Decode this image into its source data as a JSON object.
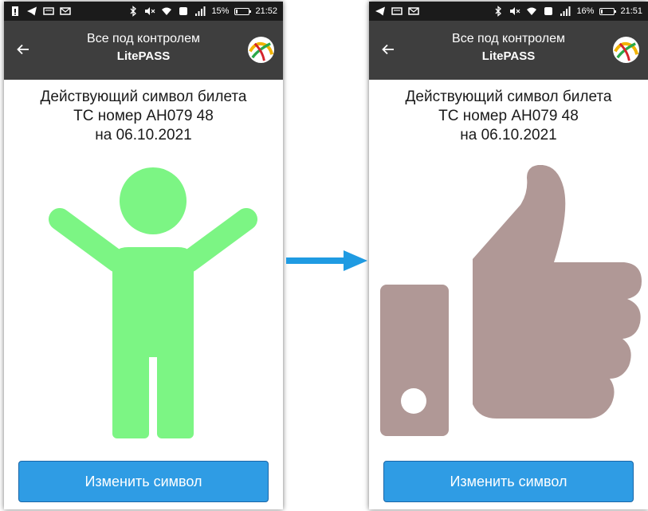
{
  "colors": {
    "statusbar": "#1b1b1b",
    "toolbar": "#3e3e3e",
    "child_symbol": "#7cf584",
    "thumb_symbol": "#b09896",
    "button": "#2f9ce4",
    "arrow": "#1f9be2"
  },
  "screens": [
    {
      "status": {
        "battery_percent": "15%",
        "time": "21:52",
        "battery_level": 0.15
      },
      "toolbar": {
        "title": "Все под контролем",
        "subtitle": "LitePASS"
      },
      "ticket": {
        "line1": "Действующий символ билета",
        "line2": "ТС номер АН079 48",
        "line3": "на 06.10.2021"
      },
      "symbol_icon": "child-figure-icon",
      "button_label": "Изменить символ"
    },
    {
      "status": {
        "battery_percent": "16%",
        "time": "21:51",
        "battery_level": 0.16
      },
      "toolbar": {
        "title": "Все под контролем",
        "subtitle": "LitePASS"
      },
      "ticket": {
        "line1": "Действующий символ билета",
        "line2": "ТС номер АН079 48",
        "line3": "на 06.10.2021"
      },
      "symbol_icon": "thumbs-up-icon",
      "button_label": "Изменить символ"
    }
  ]
}
